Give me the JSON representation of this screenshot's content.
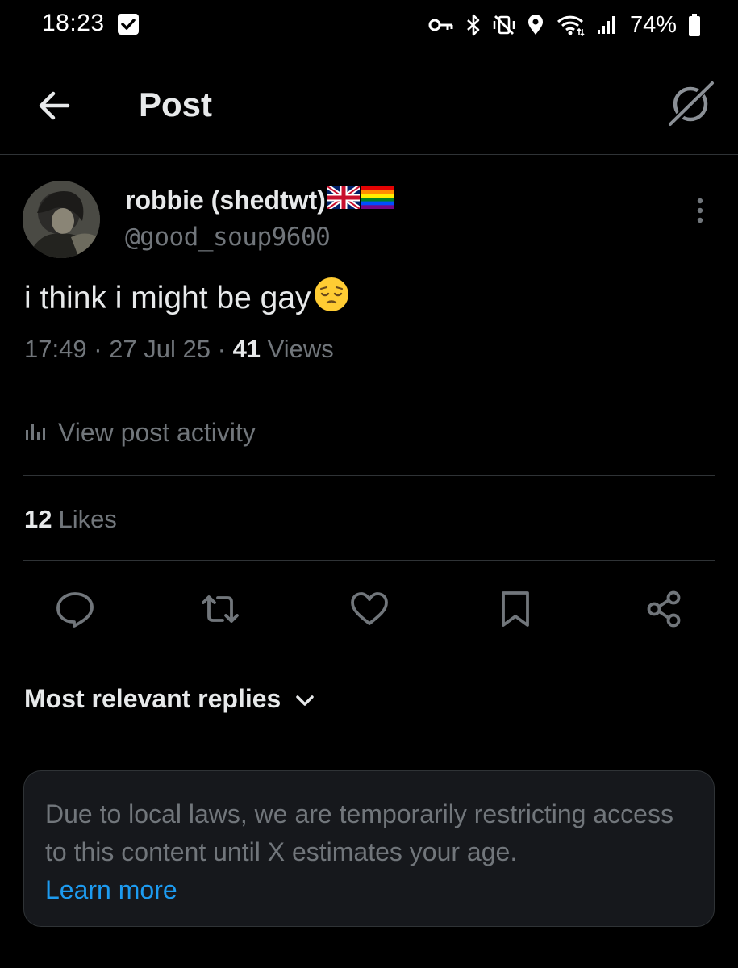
{
  "status_bar": {
    "time": "18:23",
    "battery_percent": "74%",
    "icons": [
      "checkbox-icon",
      "key-icon",
      "bluetooth-icon",
      "vibrate-mute-icon",
      "location-icon",
      "wifi-icon",
      "signal-icon",
      "battery-icon"
    ]
  },
  "header": {
    "title": "Post",
    "back_icon": "arrow-left-icon",
    "grok_icon": "grok-icon"
  },
  "post": {
    "display_name": "robbie (shedtwt)",
    "name_emojis": [
      "uk-flag",
      "rainbow-flag"
    ],
    "handle": "@good_soup9600",
    "text": "i think i might be gay",
    "text_emoji": "pensive-face",
    "time": "17:49",
    "date": "27 Jul 25",
    "separator": "·",
    "views_count": "41",
    "views_label": "Views",
    "activity_label": "View post activity",
    "likes_count": "12",
    "likes_label": "Likes"
  },
  "actions": [
    {
      "name": "reply",
      "icon": "reply-icon"
    },
    {
      "name": "repost",
      "icon": "repost-icon"
    },
    {
      "name": "like",
      "icon": "heart-icon"
    },
    {
      "name": "bookmark",
      "icon": "bookmark-icon"
    },
    {
      "name": "share",
      "icon": "share-icon"
    }
  ],
  "replies": {
    "sort_label": "Most relevant replies"
  },
  "notice": {
    "text": "Due to local laws, we are temporarily restricting access to this content until X estimates your age.",
    "link": "Learn more"
  },
  "colors": {
    "background": "#000000",
    "text_primary": "#e7e9ea",
    "text_secondary": "#71767b",
    "divider": "#2f3336",
    "link": "#1d9bf0",
    "notice_bg": "#16181c"
  }
}
